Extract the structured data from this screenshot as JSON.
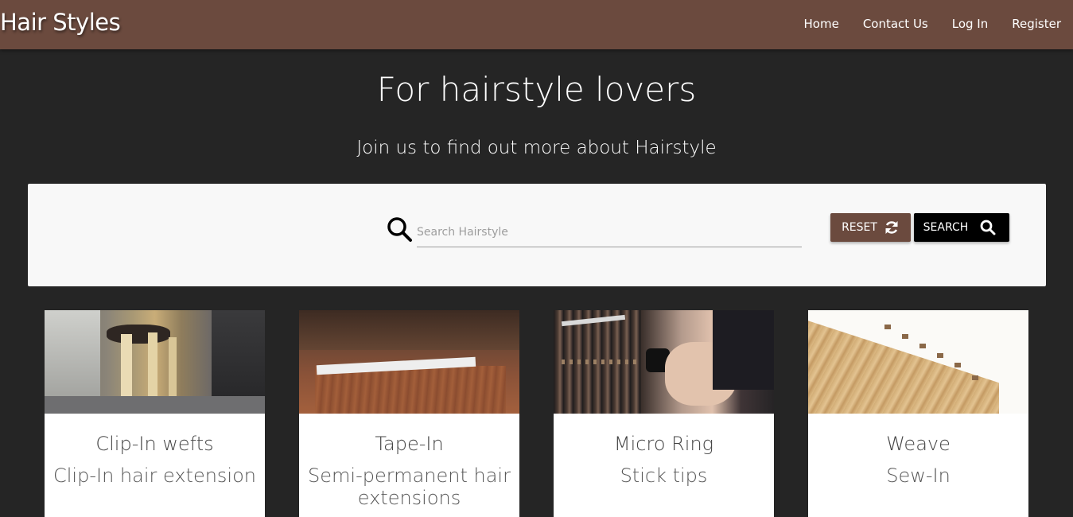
{
  "brand": "Hair Styles",
  "nav": {
    "items": [
      "Home",
      "Contact Us",
      "Log In",
      "Register"
    ]
  },
  "hero": {
    "title": "For hairstyle lovers",
    "subtitle": "Join us to find out more about Hairstyle"
  },
  "search": {
    "placeholder": "Search Hairstyle",
    "reset_label": "RESET",
    "search_label": "SEARCH"
  },
  "cards": [
    {
      "title": "Clip-In wefts",
      "description": "Clip-In hair extension"
    },
    {
      "title": "Tape-In",
      "description": "Semi-permanent hair extensions"
    },
    {
      "title": "Micro Ring",
      "description": "Stick tips"
    },
    {
      "title": "Weave",
      "description": "Sew-In"
    }
  ],
  "colors": {
    "navbar": "#6b4a3e",
    "background": "#252525",
    "panel": "#f8f8f8",
    "reset_button": "#6b4a3e",
    "search_button": "#000000"
  }
}
